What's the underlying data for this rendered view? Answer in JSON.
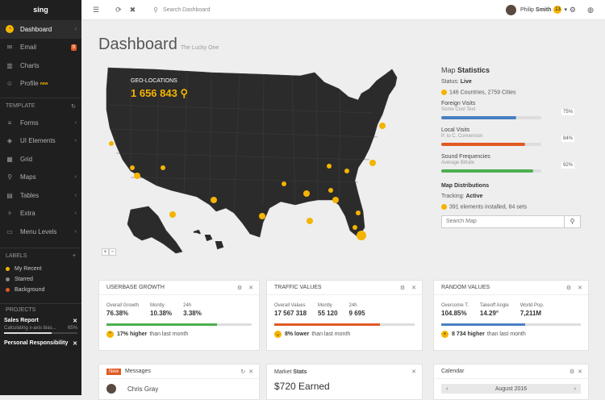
{
  "sidebar": {
    "logo": "sing",
    "main_items": [
      {
        "label": "Dashboard",
        "icon": "dashboard-icon"
      },
      {
        "label": "Email",
        "icon": "email-icon",
        "badge": "9"
      },
      {
        "label": "Charts",
        "icon": "bar-chart-icon"
      },
      {
        "label": "Profile",
        "icon": "user-icon",
        "sup": "new"
      }
    ],
    "template_title": "TEMPLATE",
    "template_items": [
      {
        "label": "Forms",
        "icon": "forms-icon"
      },
      {
        "label": "UI Elements",
        "icon": "ui-elements-icon"
      },
      {
        "label": "Grid",
        "icon": "grid-icon"
      },
      {
        "label": "Maps",
        "icon": "map-marker-icon"
      },
      {
        "label": "Tables",
        "icon": "tables-icon"
      },
      {
        "label": "Extra",
        "icon": "extra-icon"
      },
      {
        "label": "Menu Levels",
        "icon": "folder-icon"
      }
    ],
    "labels_title": "LABELS",
    "labels": [
      {
        "label": "My Recent",
        "color": "#f4b400"
      },
      {
        "label": "Starred",
        "color": "#888888"
      },
      {
        "label": "Background",
        "color": "#e05a24"
      }
    ],
    "projects_title": "PROJECTS",
    "projects": [
      {
        "title": "Sales Report",
        "sub": "Calculating x-axis bias... ",
        "pct": "65%",
        "progress": 0.65
      },
      {
        "title": "Personal Responsibility",
        "sub": "",
        "pct": "",
        "progress": 0
      }
    ]
  },
  "topbar": {
    "search_placeholder": "Search Dashboard",
    "user_first": "Philip",
    "user_last": "Smith",
    "user_badge": "13"
  },
  "page": {
    "title": "Dashboard",
    "subtitle": "The Lucky One"
  },
  "map": {
    "geo_label": "GEO-LOCATIONS",
    "geo_value": "1 656 843",
    "zoom_in": "+",
    "zoom_out": "−"
  },
  "stats": {
    "title_light": "Map",
    "title_bold": "Statistics",
    "status_label": "Status:",
    "status_value": "Live",
    "countries": "146 Countries, 2759 Cities",
    "metrics": [
      {
        "name": "Foreign Visits",
        "sub": "Some Cool Text",
        "pct": "75%",
        "value": 0.75,
        "color": "#4a7fc1"
      },
      {
        "name": "Local Visits",
        "sub": "P. to C. Conversion",
        "pct": "84%",
        "value": 0.84,
        "color": "#e05a24"
      },
      {
        "name": "Sound Frequencies",
        "sub": "Average Bitrate",
        "pct": "92%",
        "value": 0.92,
        "color": "#4caf50"
      }
    ],
    "distributions_title": "Map Distributions",
    "tracking_label": "Tracking:",
    "tracking_value": "Active",
    "installed": "391 elements installed, 84 sets",
    "search_placeholder": "Search Map"
  },
  "cards": [
    {
      "title": "USERBASE GROWTH",
      "cols": [
        {
          "l": "Overall Growth",
          "v": "76.38%"
        },
        {
          "l": "Montly",
          "v": "10.38%"
        },
        {
          "l": "24h",
          "v": "3.38%"
        }
      ],
      "bar_value": 0.76,
      "bar_color": "#4caf50",
      "foot_bold": "17% higher",
      "foot_rest": "than last month"
    },
    {
      "title": "TRAFFIC VALUES",
      "cols": [
        {
          "l": "Overall Values",
          "v": "17 567 318"
        },
        {
          "l": "Montly",
          "v": "55 120"
        },
        {
          "l": "24h",
          "v": "9 695"
        }
      ],
      "bar_value": 0.75,
      "bar_color": "#e05a24",
      "foot_bold": "8% lower",
      "foot_rest": "than last month"
    },
    {
      "title": "RANDOM VALUES",
      "cols": [
        {
          "l": "Overcome T.",
          "v": "104.85%"
        },
        {
          "l": "Takeoff Angle",
          "v": "14.29°"
        },
        {
          "l": "World Pop.",
          "v": "7,211M"
        }
      ],
      "bar_value": 0.6,
      "bar_color": "#4a7fc1",
      "foot_bold": "8 734 higher",
      "foot_rest": "than last month"
    }
  ],
  "bottom": {
    "messages_new": "New",
    "messages_title": "Messages",
    "messages_first": "Chris Gray",
    "market_light": "Market",
    "market_bold": "Stats",
    "market_value": "$720 Earned",
    "calendar_title": "Calendar",
    "calendar_month": "August 2016"
  }
}
